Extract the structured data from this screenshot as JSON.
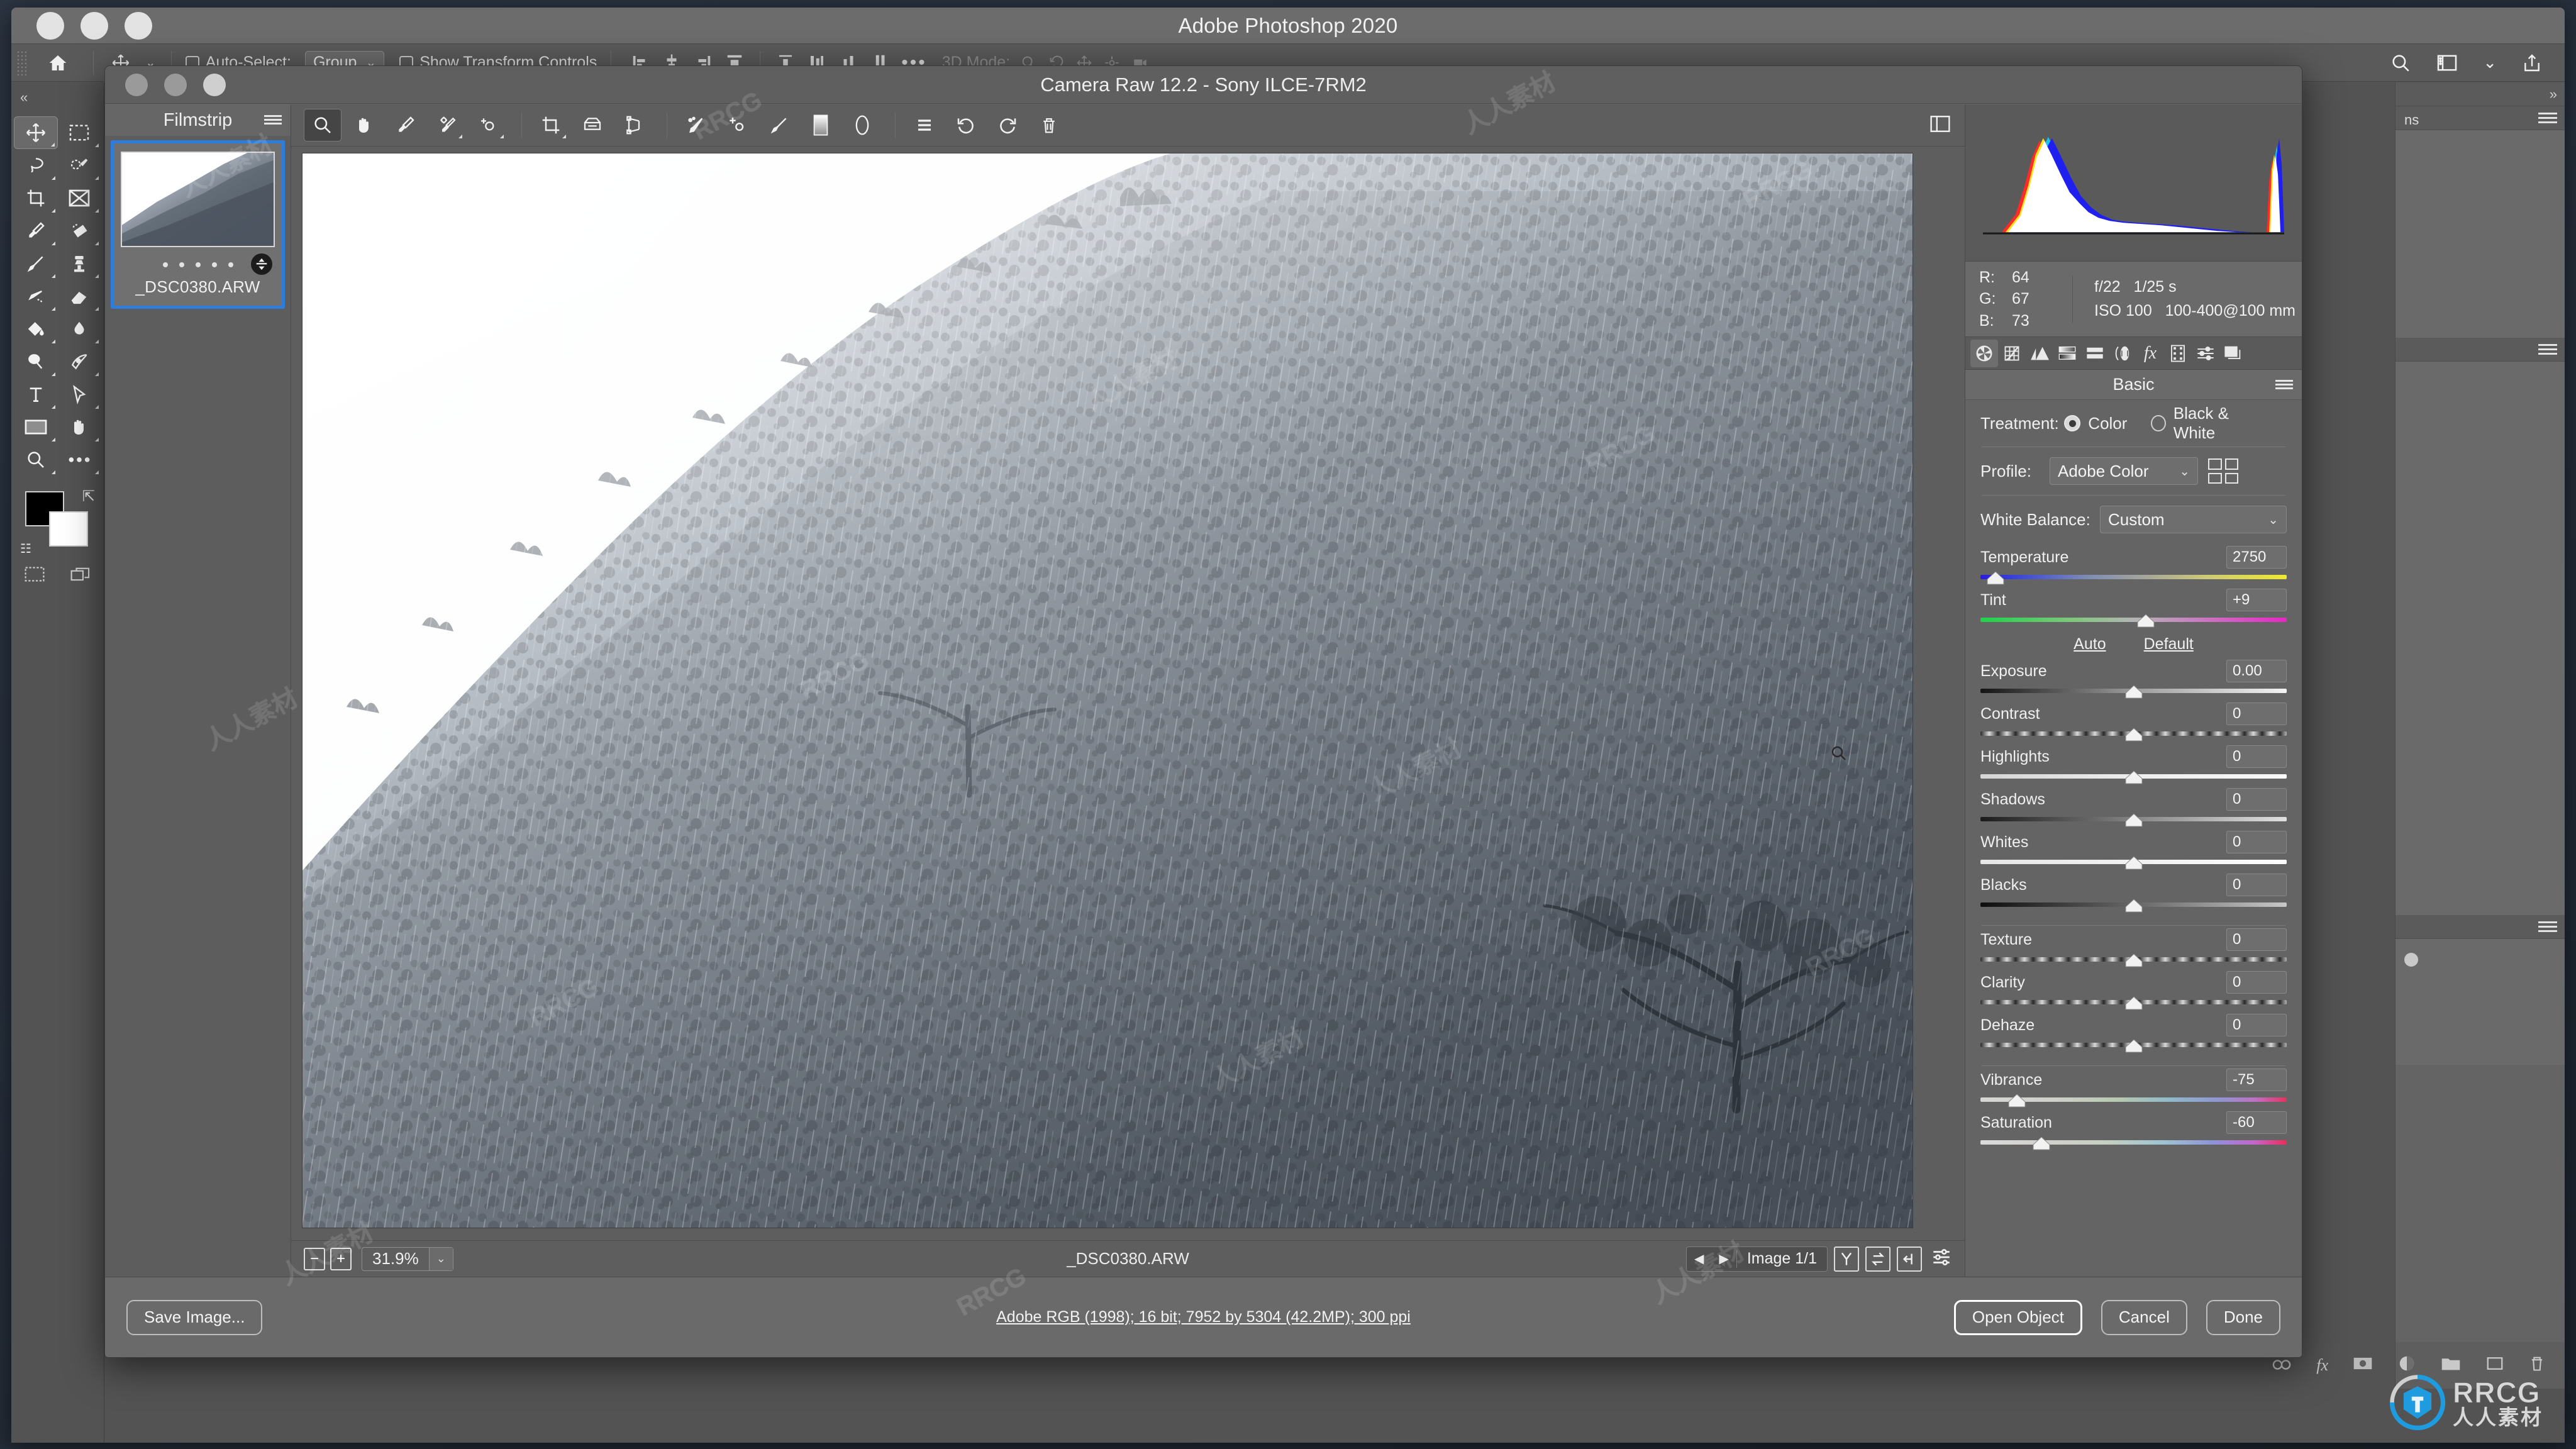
{
  "ps": {
    "title": "Adobe Photoshop 2020",
    "options_bar": {
      "home_icon": "home-icon",
      "move_tool_icon": "move-tool-icon",
      "auto_select_label": "Auto-Select:",
      "auto_select_value": "Group",
      "show_transform_label": "Show Transform Controls",
      "three_d_mode_label": "3D Mode:",
      "more_label": "•••"
    },
    "tools": [
      {
        "name": "move-tool",
        "icon": "move-icon",
        "selected": true
      },
      {
        "name": "marquee-tool",
        "icon": "rect-marquee-icon",
        "selected": false
      },
      {
        "name": "lasso-tool",
        "icon": "lasso-icon",
        "selected": false
      },
      {
        "name": "object-selection-tool",
        "icon": "quick-select-icon",
        "selected": false
      },
      {
        "name": "crop-tool",
        "icon": "crop-icon",
        "selected": false
      },
      {
        "name": "frame-tool",
        "icon": "frame-icon",
        "selected": false
      },
      {
        "name": "eyedropper-tool",
        "icon": "eyedropper-icon",
        "selected": false
      },
      {
        "name": "healing-brush-tool",
        "icon": "spot-heal-icon",
        "selected": false
      },
      {
        "name": "brush-tool",
        "icon": "brush-icon",
        "selected": false
      },
      {
        "name": "clone-stamp-tool",
        "icon": "stamp-icon",
        "selected": false
      },
      {
        "name": "history-brush-tool",
        "icon": "history-brush-icon",
        "selected": false
      },
      {
        "name": "eraser-tool",
        "icon": "eraser-icon",
        "selected": false
      },
      {
        "name": "gradient-tool",
        "icon": "paint-bucket-icon",
        "selected": false
      },
      {
        "name": "blur-tool",
        "icon": "blur-drop-icon",
        "selected": false
      },
      {
        "name": "dodge-tool",
        "icon": "dodge-icon",
        "selected": false
      },
      {
        "name": "pen-tool",
        "icon": "pen-icon",
        "selected": false
      },
      {
        "name": "type-tool",
        "icon": "type-icon",
        "selected": false
      },
      {
        "name": "path-selection-tool",
        "icon": "path-arrow-icon",
        "selected": false
      },
      {
        "name": "rectangle-tool",
        "icon": "rectangle-icon",
        "selected": false
      },
      {
        "name": "hand-tool",
        "icon": "hand-icon",
        "selected": false
      },
      {
        "name": "zoom-tool",
        "icon": "magnifier-icon",
        "selected": false
      },
      {
        "name": "edit-toolbar",
        "icon": "ellipsis-icon",
        "selected": false
      }
    ],
    "right_dock_title": "ns"
  },
  "acr": {
    "title": "Camera Raw 12.2  -  Sony ILCE-7RM2",
    "filmstrip": {
      "header": "Filmstrip",
      "menu_icon": "hamburger-icon",
      "thumbnail_name": "_DSC0380.ARW",
      "rating_dots": 5,
      "badge_icon": "adjusted-badge-icon"
    },
    "toolbar": [
      {
        "name": "zoom-tool",
        "icon": "magnifier-icon",
        "selected": true
      },
      {
        "name": "hand-tool",
        "icon": "hand-icon",
        "selected": false
      },
      {
        "name": "white-balance-tool",
        "icon": "eyedropper-icon",
        "selected": false
      },
      {
        "name": "color-sampler-tool",
        "icon": "color-sampler-icon",
        "selected": false
      },
      {
        "name": "targeted-adjustment-tool",
        "icon": "target-adjust-icon",
        "selected": false
      },
      {
        "name": "crop-tool",
        "icon": "crop-icon",
        "selected": false
      },
      {
        "name": "straighten-tool",
        "icon": "straighten-icon",
        "selected": false
      },
      {
        "name": "transform-tool",
        "icon": "transform-icon",
        "selected": false
      },
      {
        "name": "spot-removal-tool",
        "icon": "spot-removal-icon",
        "selected": false
      },
      {
        "name": "red-eye-tool",
        "icon": "red-eye-icon",
        "selected": false
      },
      {
        "name": "adjustment-brush-tool",
        "icon": "brush-icon",
        "selected": false
      },
      {
        "name": "graduated-filter-tool",
        "icon": "graduated-filter-icon",
        "selected": false
      },
      {
        "name": "radial-filter-tool",
        "icon": "radial-filter-icon",
        "selected": false
      },
      {
        "name": "preferences-tool",
        "icon": "list-icon",
        "selected": false
      },
      {
        "name": "rotate-left-tool",
        "icon": "rotate-ccw-icon",
        "selected": false
      },
      {
        "name": "rotate-right-tool",
        "icon": "rotate-cw-icon",
        "selected": false
      },
      {
        "name": "delete-tool",
        "icon": "trash-icon",
        "selected": false
      }
    ],
    "toolbar_right_icon": "fullscreen-icon",
    "statusbar": {
      "zoom_out": "−",
      "zoom_in": "+",
      "zoom_value": "31.9%",
      "zoom_caret": "⌄",
      "filename": "_DSC0380.ARW",
      "prev_arrow": "◀",
      "next_arrow": "▶",
      "image_counter": "Image 1/1",
      "btn_y_icon": "preview-toggle-icon",
      "btn_swap_icon": "before-after-swap-icon",
      "btn_copy_icon": "copy-settings-icon",
      "btn_settings_icon": "sliders-icon"
    },
    "histogram": {
      "shadow_clip_icon": "shadow-clipping-icon",
      "highlight_clip_icon": "highlight-clipping-icon"
    },
    "readout": {
      "r_label": "R:",
      "r_value": "64",
      "g_label": "G:",
      "g_value": "67",
      "b_label": "B:",
      "b_value": "73",
      "aperture": "f/22",
      "shutter": "1/25 s",
      "iso": "ISO 100",
      "lens": "100-400@100 mm"
    },
    "panel_tabs": [
      {
        "name": "basic-tab",
        "icon": "aperture-icon",
        "selected": true
      },
      {
        "name": "tone-curve-tab",
        "icon": "curve-grid-icon",
        "selected": false
      },
      {
        "name": "detail-tab",
        "icon": "triangles-icon",
        "selected": false
      },
      {
        "name": "color-mixer-tab",
        "icon": "gradient-bars-icon",
        "selected": false
      },
      {
        "name": "split-toning-tab",
        "icon": "split-bars-icon",
        "selected": false
      },
      {
        "name": "optics-tab",
        "icon": "lens-icon",
        "selected": false
      },
      {
        "name": "effects-tab",
        "icon": "fx-icon",
        "selected": false
      },
      {
        "name": "calibration-tab",
        "icon": "filmstrip-icon",
        "selected": false
      },
      {
        "name": "presets-tab",
        "icon": "sliders-icon",
        "selected": false
      },
      {
        "name": "snapshots-tab",
        "icon": "layers-icon",
        "selected": false
      }
    ],
    "basic": {
      "header": "Basic",
      "menu_icon": "hamburger-icon",
      "treatment_label": "Treatment:",
      "treatment_options": [
        {
          "label": "Color",
          "selected": true
        },
        {
          "label": "Black & White",
          "selected": false
        }
      ],
      "profile_label": "Profile:",
      "profile_value": "Adobe Color",
      "profile_browse_icon": "profile-browser-icon",
      "white_balance_label": "White Balance:",
      "white_balance_value": "Custom",
      "auto_label": "Auto",
      "default_label": "Default",
      "sliders": [
        {
          "name": "Temperature",
          "value": "2750",
          "pos": 5,
          "track": "temp"
        },
        {
          "name": "Tint",
          "value": "+9",
          "pos": 54,
          "track": "tint"
        },
        {
          "name": "Exposure",
          "value": "0.00",
          "pos": 50,
          "track": "exposure"
        },
        {
          "name": "Contrast",
          "value": "0",
          "pos": 50,
          "track": "contrast"
        },
        {
          "name": "Highlights",
          "value": "0",
          "pos": 50,
          "track": "light"
        },
        {
          "name": "Shadows",
          "value": "0",
          "pos": 50,
          "track": "shadow"
        },
        {
          "name": "Whites",
          "value": "0",
          "pos": 50,
          "track": "whites"
        },
        {
          "name": "Blacks",
          "value": "0",
          "pos": 50,
          "track": "blacks"
        },
        {
          "name": "Texture",
          "value": "0",
          "pos": 50,
          "track": "contrast"
        },
        {
          "name": "Clarity",
          "value": "0",
          "pos": 50,
          "track": "contrast"
        },
        {
          "name": "Dehaze",
          "value": "0",
          "pos": 50,
          "track": "contrast"
        },
        {
          "name": "Vibrance",
          "value": "-75",
          "pos": 12,
          "track": "vib"
        },
        {
          "name": "Saturation",
          "value": "-60",
          "pos": 20,
          "track": "sat"
        }
      ]
    },
    "bottom": {
      "save_image": "Save Image...",
      "workflow_info": "Adobe RGB (1998); 16 bit; 7952 by 5304 (42.2MP); 300 ppi",
      "open_object": "Open Object",
      "cancel": "Cancel",
      "done": "Done"
    }
  },
  "watermark": {
    "brand": "RRCG",
    "brand_cn": "人人素材",
    "tiles": [
      "RRCG",
      "人人素材",
      "RRCG",
      "人人素材"
    ]
  },
  "colors": {
    "accent_blue": "#2f7ddb",
    "panel_bg": "#646464",
    "toolbar_bg": "#5e5e5e",
    "logo_blue": "#1f9ce0"
  }
}
